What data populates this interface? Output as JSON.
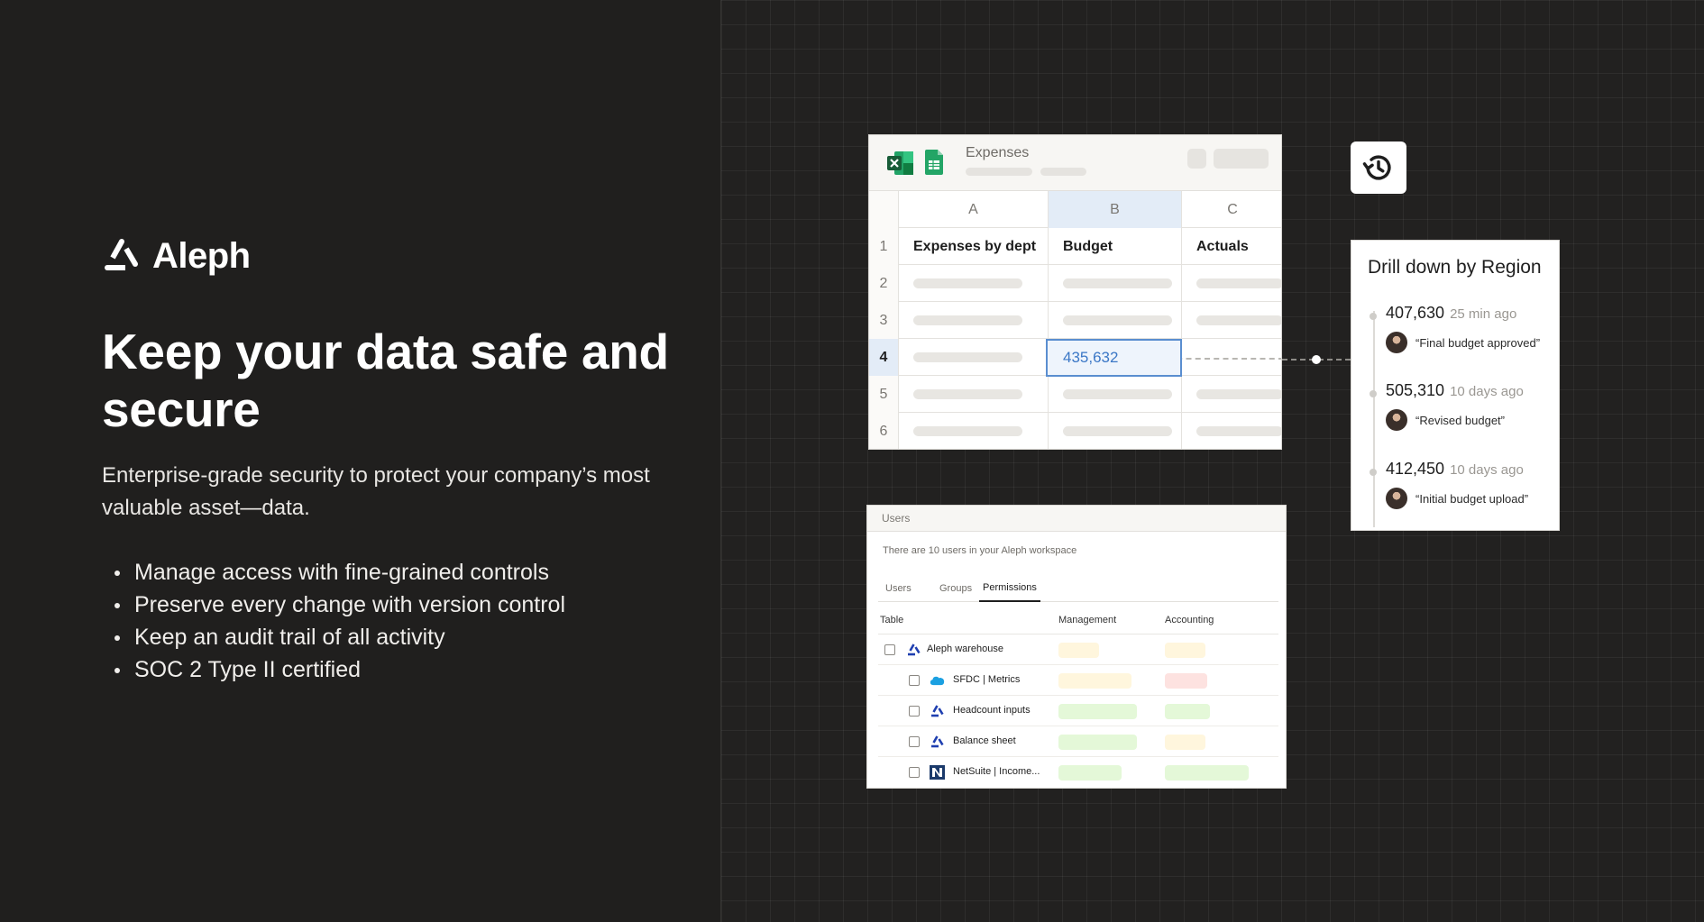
{
  "brand": {
    "name": "Aleph",
    "logo_icon": "aleph-logo-icon"
  },
  "hero": {
    "headline": "Keep your data safe and secure",
    "subhead": "Enterprise-grade security to protect your company’s most valuable asset—data.",
    "bullets": [
      "Manage access with fine-grained controls",
      "Preserve every change with version control",
      "Keep an audit trail of all activity",
      "SOC 2 Type II certified"
    ]
  },
  "sheet": {
    "title": "Expenses",
    "icons": [
      "excel-icon",
      "google-sheets-icon"
    ],
    "columns": [
      "A",
      "B",
      "C"
    ],
    "row_numbers": [
      "1",
      "2",
      "3",
      "4",
      "5",
      "6"
    ],
    "header_cells": [
      "Expenses by dept",
      "Budget",
      "Actuals"
    ],
    "active_value": "435,632"
  },
  "history_button": {
    "icon": "history-icon"
  },
  "drill": {
    "title": "Drill down by Region",
    "items": [
      {
        "value": "407,630",
        "time": "25 min ago",
        "note": "“Final budget approved”"
      },
      {
        "value": "505,310",
        "time": "10 days ago",
        "note": "“Revised budget”"
      },
      {
        "value": "412,450",
        "time": "10 days ago",
        "note": "“Initial budget upload”"
      }
    ]
  },
  "users": {
    "title": "Users",
    "info": "There are 10 users in your Aleph workspace",
    "tabs": [
      "Users",
      "Groups",
      "Permissions"
    ],
    "active_tab": "Permissions",
    "columns": [
      "Table",
      "Management",
      "Accounting"
    ],
    "rows": [
      {
        "name": "Aleph warehouse",
        "icon": "aleph-icon",
        "management": "yellow",
        "accounting": "yellow"
      },
      {
        "name": "SFDC | Metrics",
        "icon": "salesforce-icon",
        "management": "yellow",
        "accounting": "red"
      },
      {
        "name": "Headcount inputs",
        "icon": "aleph-icon",
        "management": "green",
        "accounting": "green"
      },
      {
        "name": "Balance sheet",
        "icon": "aleph-icon",
        "management": "green",
        "accounting": "yellow"
      },
      {
        "name": "NetSuite | Income...",
        "icon": "netsuite-icon",
        "management": "green",
        "accounting": "green"
      }
    ]
  },
  "colors": {
    "background": "#201f1e",
    "accent_blue": "#3b77c6",
    "pill_yellow": "#fff6dd",
    "pill_red": "#fde2e0",
    "pill_green": "#e4f8d8"
  }
}
